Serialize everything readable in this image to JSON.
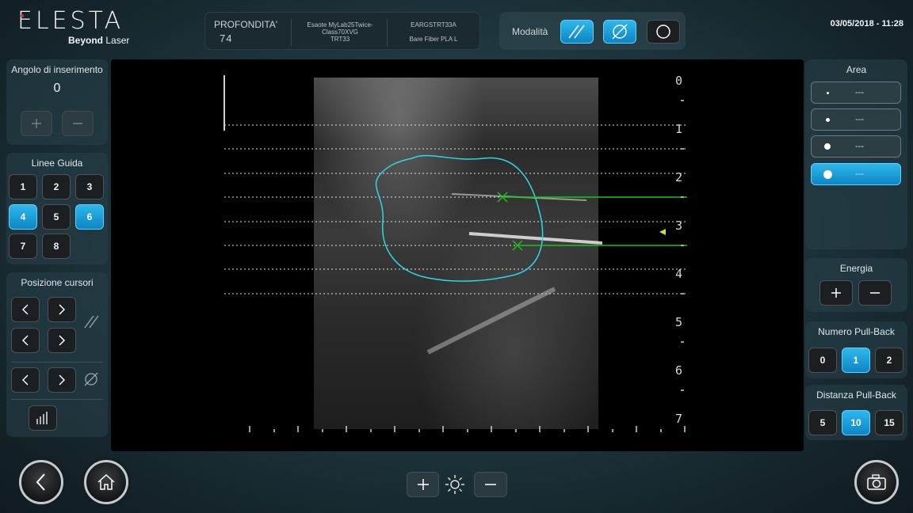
{
  "header": {
    "brand": "ELESTA",
    "tagline_bold": "Beyond",
    "tagline_rest": " Laser",
    "depth_label": "PROFONDITA'",
    "depth_value": "74",
    "device": "Esaote MyLab25Twice-Class70XVG",
    "probe": "TRT33",
    "code": "EARGSTRT33A",
    "fiber": "Bare Fiber PLA L",
    "mode_label": "Modalità",
    "datetime": "03/05/2018 - 11:28"
  },
  "left_panel": {
    "angle": {
      "title": "Angolo di inserimento",
      "value": "0"
    },
    "guides": {
      "title": "Linee Guida",
      "buttons": [
        "1",
        "2",
        "3",
        "4",
        "5",
        "6",
        "7",
        "8"
      ],
      "active": [
        "4",
        "6"
      ]
    },
    "cursors": {
      "title": "Posizione cursori"
    }
  },
  "right_panel": {
    "area": {
      "title": "Area",
      "options": [
        "---",
        "---",
        "---",
        "---"
      ],
      "active_index": 3
    },
    "energy": {
      "title": "Energia"
    },
    "pullback_count": {
      "title": "Numero Pull-Back",
      "options": [
        "0",
        "1",
        "2"
      ],
      "active": "1"
    },
    "pullback_distance": {
      "title": "Distanza Pull-Back",
      "options": [
        "5",
        "10",
        "15"
      ],
      "active": "10"
    }
  },
  "viewer": {
    "depth_ticks": [
      "0",
      "1",
      "2",
      "3",
      "4",
      "5",
      "6",
      "7"
    ]
  },
  "colors": {
    "accent": "#1aa7e0",
    "contour": "#2fd6e6",
    "guide": "#18c418"
  },
  "icons": {
    "back": "chevron-left-icon",
    "home": "home-icon",
    "camera": "camera-icon",
    "brightness": "sun-icon"
  }
}
